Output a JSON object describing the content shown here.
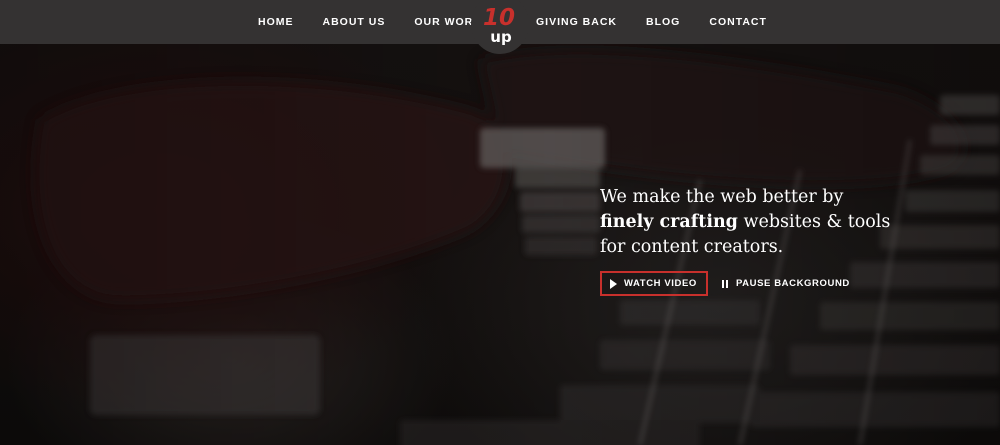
{
  "brand": {
    "logo_text_top": "10",
    "logo_text_bottom": "up",
    "accent_color": "#c8302c",
    "nav_background": "#343232"
  },
  "nav": {
    "left": [
      {
        "label": "HOME"
      },
      {
        "label": "ABOUT US"
      },
      {
        "label": "OUR WORK"
      }
    ],
    "right": [
      {
        "label": "GIVING BACK"
      },
      {
        "label": "BLOG"
      },
      {
        "label": "CONTACT"
      }
    ]
  },
  "hero": {
    "headline_line1": "We make the web better by",
    "headline_bold": "finely crafting",
    "headline_line2_rest": " websites & tools",
    "headline_line3": "for content creators.",
    "watch_video_label": "WATCH VIDEO",
    "watch_video_icon": "play-icon",
    "pause_background_label": "PAUSE BACKGROUND",
    "pause_background_icon": "pause-icon"
  }
}
